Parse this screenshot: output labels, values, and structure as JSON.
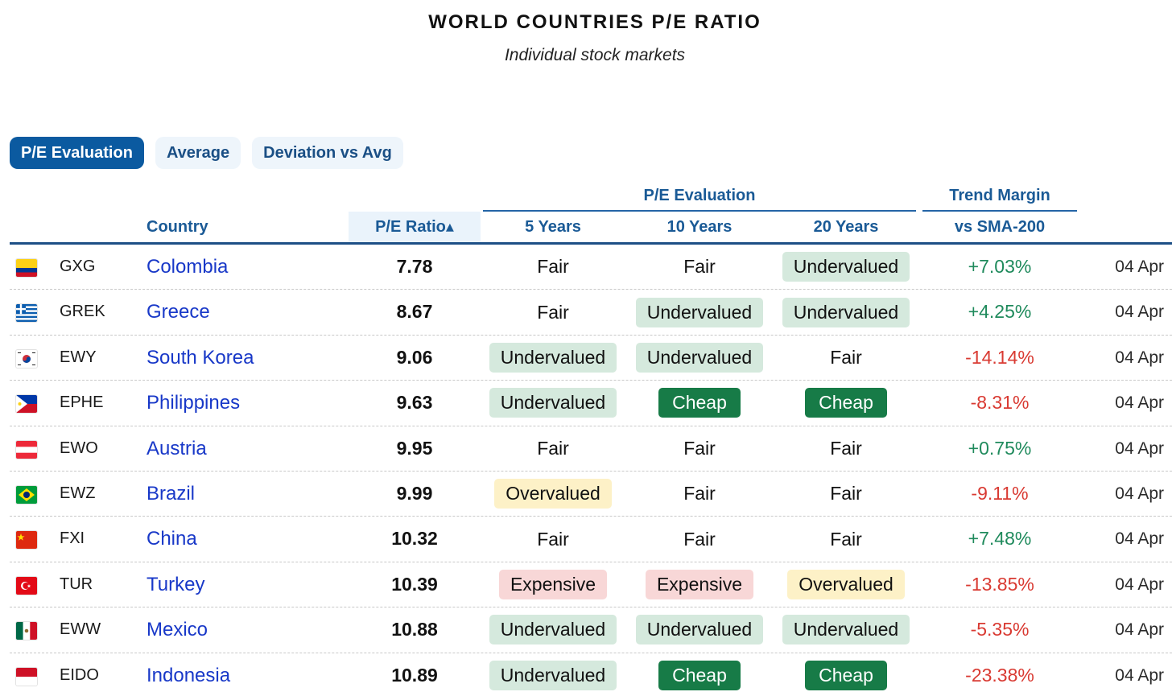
{
  "header": {
    "title": "WORLD COUNTRIES P/E RATIO",
    "subtitle": "Individual stock markets"
  },
  "tabs": [
    {
      "label": "P/E Evaluation",
      "active": true
    },
    {
      "label": "Average",
      "active": false
    },
    {
      "label": "Deviation vs Avg",
      "active": false
    }
  ],
  "columns": {
    "group_pe": "P/E Evaluation",
    "group_trend": "Trend Margin",
    "country": "Country",
    "pe_ratio": "P/E Ratio▴",
    "y5": "5 Years",
    "y10": "10 Years",
    "y20": "20 Years",
    "sma": "vs SMA-200"
  },
  "colors": {
    "accent": "#0b5aa0",
    "link": "#1838c8",
    "positive": "#1f8a5c",
    "negative": "#d93a32",
    "undervalued": "#d5e9dd",
    "cheap": "#177b47",
    "overvalued": "#fdf1c7",
    "expensive": "#f8d7d7"
  },
  "rows": [
    {
      "flag": "colombia-flag-icon",
      "ticker": "GXG",
      "country": "Colombia",
      "pe": "7.78",
      "y5": "Fair",
      "y10": "Fair",
      "y20": "Undervalued",
      "trend": "+7.03%",
      "date": "04 Apr"
    },
    {
      "flag": "greece-flag-icon",
      "ticker": "GREK",
      "country": "Greece",
      "pe": "8.67",
      "y5": "Fair",
      "y10": "Undervalued",
      "y20": "Undervalued",
      "trend": "+4.25%",
      "date": "04 Apr"
    },
    {
      "flag": "south-korea-flag-icon",
      "ticker": "EWY",
      "country": "South Korea",
      "pe": "9.06",
      "y5": "Undervalued",
      "y10": "Undervalued",
      "y20": "Fair",
      "trend": "-14.14%",
      "date": "04 Apr"
    },
    {
      "flag": "philippines-flag-icon",
      "ticker": "EPHE",
      "country": "Philippines",
      "pe": "9.63",
      "y5": "Undervalued",
      "y10": "Cheap",
      "y20": "Cheap",
      "trend": "-8.31%",
      "date": "04 Apr"
    },
    {
      "flag": "austria-flag-icon",
      "ticker": "EWO",
      "country": "Austria",
      "pe": "9.95",
      "y5": "Fair",
      "y10": "Fair",
      "y20": "Fair",
      "trend": "+0.75%",
      "date": "04 Apr"
    },
    {
      "flag": "brazil-flag-icon",
      "ticker": "EWZ",
      "country": "Brazil",
      "pe": "9.99",
      "y5": "Overvalued",
      "y10": "Fair",
      "y20": "Fair",
      "trend": "-9.11%",
      "date": "04 Apr"
    },
    {
      "flag": "china-flag-icon",
      "ticker": "FXI",
      "country": "China",
      "pe": "10.32",
      "y5": "Fair",
      "y10": "Fair",
      "y20": "Fair",
      "trend": "+7.48%",
      "date": "04 Apr"
    },
    {
      "flag": "turkey-flag-icon",
      "ticker": "TUR",
      "country": "Turkey",
      "pe": "10.39",
      "y5": "Expensive",
      "y10": "Expensive",
      "y20": "Overvalued",
      "trend": "-13.85%",
      "date": "04 Apr"
    },
    {
      "flag": "mexico-flag-icon",
      "ticker": "EWW",
      "country": "Mexico",
      "pe": "10.88",
      "y5": "Undervalued",
      "y10": "Undervalued",
      "y20": "Undervalued",
      "trend": "-5.35%",
      "date": "04 Apr"
    },
    {
      "flag": "indonesia-flag-icon",
      "ticker": "EIDO",
      "country": "Indonesia",
      "pe": "10.89",
      "y5": "Undervalued",
      "y10": "Cheap",
      "y20": "Cheap",
      "trend": "-23.38%",
      "date": "04 Apr"
    }
  ]
}
